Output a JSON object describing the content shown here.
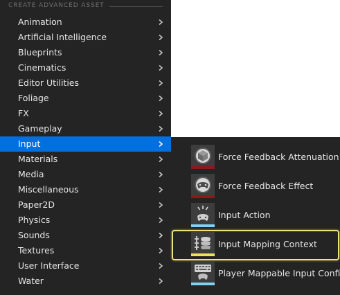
{
  "menu": {
    "header": "CREATE ADVANCED ASSET",
    "items": [
      {
        "label": "Animation"
      },
      {
        "label": "Artificial Intelligence"
      },
      {
        "label": "Blueprints"
      },
      {
        "label": "Cinematics"
      },
      {
        "label": "Editor Utilities"
      },
      {
        "label": "Foliage"
      },
      {
        "label": "FX"
      },
      {
        "label": "Gameplay"
      },
      {
        "label": "Input",
        "active": true
      },
      {
        "label": "Materials"
      },
      {
        "label": "Media"
      },
      {
        "label": "Miscellaneous"
      },
      {
        "label": "Paper2D"
      },
      {
        "label": "Physics"
      },
      {
        "label": "Sounds"
      },
      {
        "label": "Textures"
      },
      {
        "label": "User Interface"
      },
      {
        "label": "Water"
      }
    ]
  },
  "submenu": {
    "items": [
      {
        "label": "Force Feedback Attenuation",
        "icon": "force-feedback-attenuation-icon",
        "bar_color": "#8b1a1a"
      },
      {
        "label": "Force Feedback Effect",
        "icon": "force-feedback-effect-icon",
        "bar_color": "#8b1a1a"
      },
      {
        "label": "Input Action",
        "icon": "input-action-icon",
        "bar_color": "#7fd3f0"
      },
      {
        "label": "Input Mapping Context",
        "icon": "input-mapping-context-icon",
        "bar_color": "#f0e060",
        "highlighted": true
      },
      {
        "label": "Player Mappable Input Config",
        "icon": "player-mappable-input-config-icon",
        "bar_color": "#7fd3f0"
      }
    ]
  },
  "colors": {
    "menu_bg": "#242424",
    "active_bg": "#0070e0",
    "highlight_border": "#f2e27a"
  }
}
